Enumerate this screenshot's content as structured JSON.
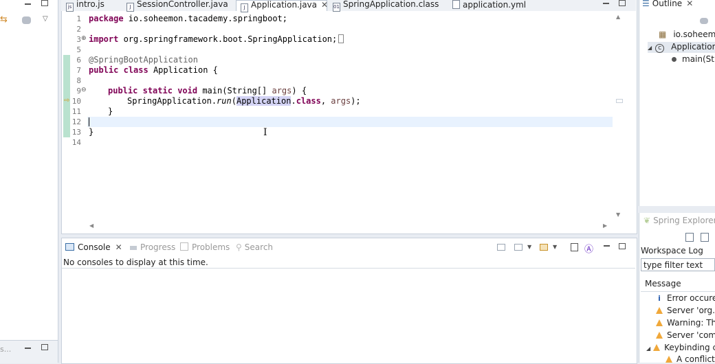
{
  "editor": {
    "tabs": [
      {
        "label": "intro.js",
        "icon": "js-file-icon",
        "active": false
      },
      {
        "label": "SessionController.java",
        "icon": "java-file-icon",
        "active": false
      },
      {
        "label": "Application.java",
        "icon": "java-file-icon",
        "active": true
      },
      {
        "label": "SpringApplication.class",
        "icon": "class-file-icon",
        "active": false
      },
      {
        "label": "application.yml",
        "icon": "yml-file-icon",
        "active": false
      }
    ],
    "line_numbers": [
      "1",
      "2",
      "3",
      "5",
      "6",
      "7",
      "8",
      "9",
      "10",
      "11",
      "12",
      "13",
      "14"
    ],
    "code": {
      "l1_kw": "package",
      "l1_rest": " io.soheemon.tacademy.springboot;",
      "l3_kw": "import",
      "l3_rest": " org.springframework.boot.SpringApplication;",
      "l6": "@SpringBootApplication",
      "l7_kw1": "public",
      "l7_kw2": "class",
      "l7_rest": " Application {",
      "l9_kw1": "public",
      "l9_kw2": "static",
      "l9_kw3": "void",
      "l9_a": " main(String[] ",
      "l9_param": "args",
      "l9_b": ") {",
      "l10_a": "SpringApplication.",
      "l10_call": "run",
      "l10_b": "(",
      "l10_hl": "Application",
      "l10_c": ".",
      "l10_kw": "class",
      "l10_d": ", ",
      "l10_param": "args",
      "l10_e": ");",
      "l11": "}",
      "l13": "}"
    }
  },
  "console": {
    "tabs": [
      {
        "label": "Console",
        "active": true,
        "icon": "console-icon"
      },
      {
        "label": "Progress",
        "active": false,
        "icon": "progress-icon"
      },
      {
        "label": "Problems",
        "active": false,
        "icon": "problems-icon"
      },
      {
        "label": "Search",
        "active": false,
        "icon": "search-icon"
      }
    ],
    "message": "No consoles to display at this time."
  },
  "outline": {
    "title": "Outline",
    "items": [
      {
        "label": "io.soheemon",
        "icon": "package-icon"
      },
      {
        "label": "Application",
        "icon": "class-icon"
      },
      {
        "label": "main(St",
        "icon": "method-icon"
      }
    ]
  },
  "spring_explorer": {
    "title": "Spring Explorer",
    "workspace_log": "Workspace Log",
    "filter_placeholder": "type filter text",
    "column_header": "Message",
    "messages": [
      {
        "text": "Error occured",
        "icon": "info-icon"
      },
      {
        "text": "Server 'org.e",
        "icon": "warning-icon"
      },
      {
        "text": "Warning: The",
        "icon": "warning-icon"
      },
      {
        "text": "Server 'com.",
        "icon": "warning-icon"
      },
      {
        "text": "Keybinding c",
        "icon": "warning-icon"
      },
      {
        "text": "A conflict",
        "icon": "warning-icon"
      }
    ]
  },
  "left_panel": {
    "bottom_label": "s..."
  },
  "colors": {
    "keyword": "#7f0055",
    "annotation": "#646464",
    "param": "#6a3e3e",
    "current_line": "#e8f2fe",
    "selection": "#d4d4f5"
  }
}
